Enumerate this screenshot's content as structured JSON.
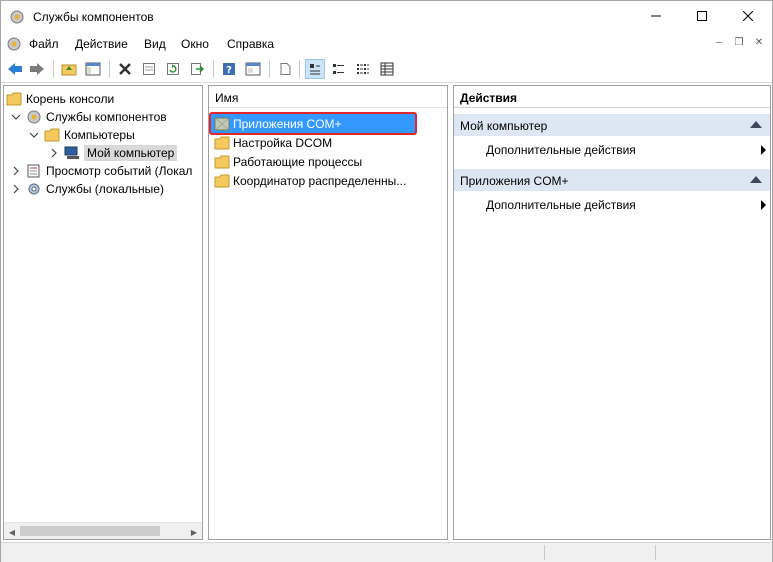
{
  "window": {
    "title": "Службы компонентов"
  },
  "menu": {
    "items": [
      "Файл",
      "Действие",
      "Вид",
      "Окно",
      "Справка"
    ]
  },
  "toolbar": {
    "icons": [
      "back-arrow-icon",
      "forward-arrow-icon",
      "up-folder-icon",
      "show-hide-tree-icon",
      "delete-icon",
      "properties-icon",
      "refresh-icon",
      "export-icon",
      "help-icon",
      "console-view-icon",
      "new-window-icon",
      "large-icons-view-icon",
      "small-icons-view-icon",
      "list-view-icon",
      "details-view-icon"
    ]
  },
  "tree": {
    "items": [
      {
        "label": "Корень консоли",
        "expanded": true
      },
      {
        "label": "Службы компонентов",
        "expanded": true
      },
      {
        "label": "Компьютеры",
        "expanded": true
      },
      {
        "label": "Мой компьютер",
        "expanded": false,
        "selected": true
      },
      {
        "label": "Просмотр событий (Локал",
        "expanded": false
      },
      {
        "label": "Службы (локальные)",
        "expanded": false
      }
    ]
  },
  "list": {
    "column_header": "Имя",
    "rows": [
      {
        "label": "Приложения COM+",
        "selected": true,
        "highlighted": true
      },
      {
        "label": "Настройка DCOM"
      },
      {
        "label": "Работающие процессы"
      },
      {
        "label": "Координатор распределенны..."
      }
    ]
  },
  "actions": {
    "title": "Действия",
    "sections": [
      {
        "header": "Мой компьютер",
        "items": [
          "Дополнительные действия"
        ]
      },
      {
        "header": "Приложения COM+",
        "items": [
          "Дополнительные действия"
        ]
      }
    ]
  },
  "colors": {
    "selection": "#3399ff",
    "highlight_border": "#e0262b",
    "section_bg": "#dce7f3",
    "folder": "#f4c95d"
  }
}
